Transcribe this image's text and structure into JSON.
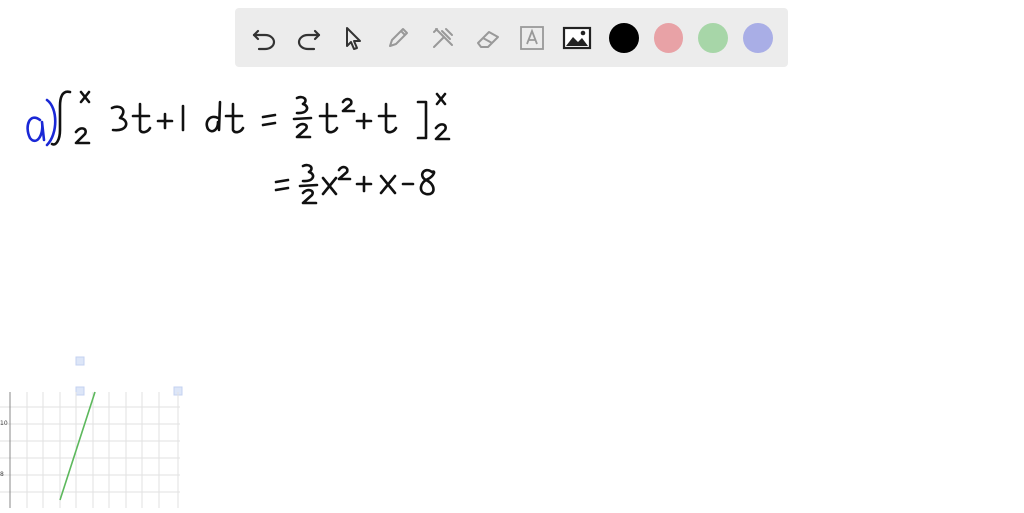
{
  "toolbar": {
    "tools": [
      {
        "name": "undo-icon"
      },
      {
        "name": "redo-icon"
      },
      {
        "name": "select-pointer-icon"
      },
      {
        "name": "pen-icon"
      },
      {
        "name": "tools-icon"
      },
      {
        "name": "eraser-icon"
      },
      {
        "name": "text-box-icon"
      },
      {
        "name": "image-icon"
      }
    ],
    "colors": [
      {
        "name": "black",
        "hex": "#000000"
      },
      {
        "name": "red",
        "hex": "#e8a2a6"
      },
      {
        "name": "green",
        "hex": "#a7d6a8"
      },
      {
        "name": "blue",
        "hex": "#a9aee6"
      }
    ]
  },
  "graph": {
    "tick_labels": [
      "10",
      "8"
    ],
    "line_color": "#5cb85c"
  },
  "colors": {
    "ink": "#111111",
    "label_ink": "#1a28d6",
    "toolbar_bg": "#ececec"
  }
}
